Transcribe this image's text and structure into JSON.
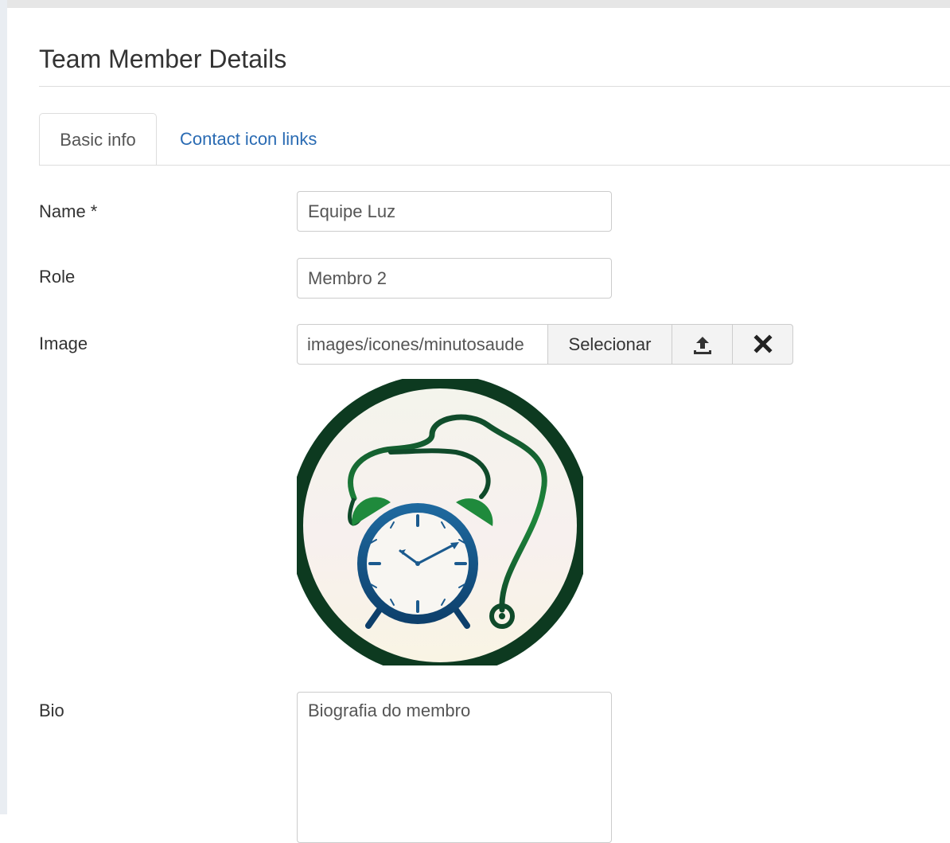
{
  "page": {
    "title": "Team Member Details"
  },
  "tabs": [
    {
      "label": "Basic info",
      "active": true
    },
    {
      "label": "Contact icon links",
      "active": false
    }
  ],
  "form": {
    "name": {
      "label": "Name *",
      "value": "Equipe Luz"
    },
    "role": {
      "label": "Role",
      "value": "Membro 2"
    },
    "image": {
      "label": "Image",
      "value": "images/icones/minutosaude",
      "select_label": "Selecionar",
      "upload_icon": "upload-icon",
      "clear_icon": "close-icon",
      "preview_icon": "alarm-clock-stethoscope-logo"
    },
    "bio": {
      "label": "Bio",
      "value": "Biografia do membro"
    }
  },
  "colors": {
    "link": "#2a6bb3",
    "logo_dark_green": "#0f3d22",
    "logo_green": "#1f8a3c",
    "logo_blue": "#1b5a8e",
    "logo_bg": "#f7f3ec"
  }
}
